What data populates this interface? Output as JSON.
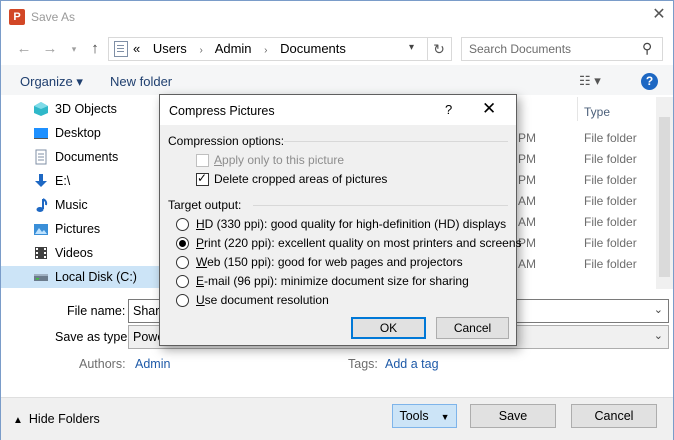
{
  "window": {
    "title": "Save As",
    "app_icon": "powerpoint-icon"
  },
  "address": {
    "prefix": "«",
    "crumbs": [
      "Users",
      "Admin",
      "Documents"
    ],
    "search_placeholder": "Search Documents"
  },
  "toolbar": {
    "organize": "Organize ▾",
    "new_folder": "New folder",
    "view": "☷ ▾",
    "help": "?"
  },
  "sidebar": {
    "items": [
      {
        "label": "3D Objects",
        "icon": "3d-objects-icon",
        "color": "#2fb8c9"
      },
      {
        "label": "Desktop",
        "icon": "desktop-icon",
        "color": "#1e90ff"
      },
      {
        "label": "Documents",
        "icon": "documents-icon",
        "color": "#7f8fa6"
      },
      {
        "label": "E:\\",
        "icon": "download-arrow-icon",
        "color": "#1e68c3"
      },
      {
        "label": "Music",
        "icon": "music-note-icon",
        "color": "#1e68c3"
      },
      {
        "label": "Pictures",
        "icon": "pictures-icon",
        "color": "#3a8fd8"
      },
      {
        "label": "Videos",
        "icon": "videos-icon",
        "color": "#404040"
      },
      {
        "label": "Local Disk (C:)",
        "icon": "local-disk-icon",
        "color": "#6b7b8c"
      }
    ],
    "selected": "Local Disk (C:)"
  },
  "file_list": {
    "type_header": "Type",
    "rows": [
      {
        "time": "PM",
        "type": "File folder"
      },
      {
        "time": "PM",
        "type": "File folder"
      },
      {
        "time": "PM",
        "type": "File folder"
      },
      {
        "time": "AM",
        "type": "File folder"
      },
      {
        "time": "AM",
        "type": "File folder"
      },
      {
        "time": "PM",
        "type": "File folder"
      },
      {
        "time": "AM",
        "type": "File folder"
      }
    ]
  },
  "form": {
    "file_name_label": "File name:",
    "file_name_value": "Share",
    "save_as_type_label": "Save as type:",
    "save_as_type_value": "Powe",
    "authors_label": "Authors:",
    "authors_value": "Admin",
    "tags_label": "Tags:",
    "tags_value": "Add a tag"
  },
  "bottom": {
    "hide_folders": "Hide Folders",
    "tools": "Tools",
    "save": "Save",
    "cancel": "Cancel"
  },
  "dialog": {
    "title": "Compress Pictures",
    "help": "?",
    "close": "✕",
    "compression_group": "Compression options:",
    "apply_only": {
      "label": "Apply only to this picture",
      "checked": false,
      "disabled": true
    },
    "delete_cropped": {
      "label": "Delete cropped areas of pictures",
      "checked": true
    },
    "target_group": "Target output:",
    "options": [
      {
        "key": "H",
        "rest": "D (330 ppi): good quality for high-definition (HD) displays",
        "selected": false
      },
      {
        "key": "P",
        "rest": "rint (220 ppi): excellent quality on most printers and screens",
        "selected": true
      },
      {
        "key": "W",
        "rest": "eb (150 ppi): good for web pages and projectors",
        "selected": false
      },
      {
        "key": "E",
        "rest": "-mail (96 ppi): minimize document size for sharing",
        "selected": false
      },
      {
        "key": "U",
        "rest": "se document resolution",
        "selected": false
      }
    ],
    "ok": "OK",
    "cancel": "Cancel"
  }
}
